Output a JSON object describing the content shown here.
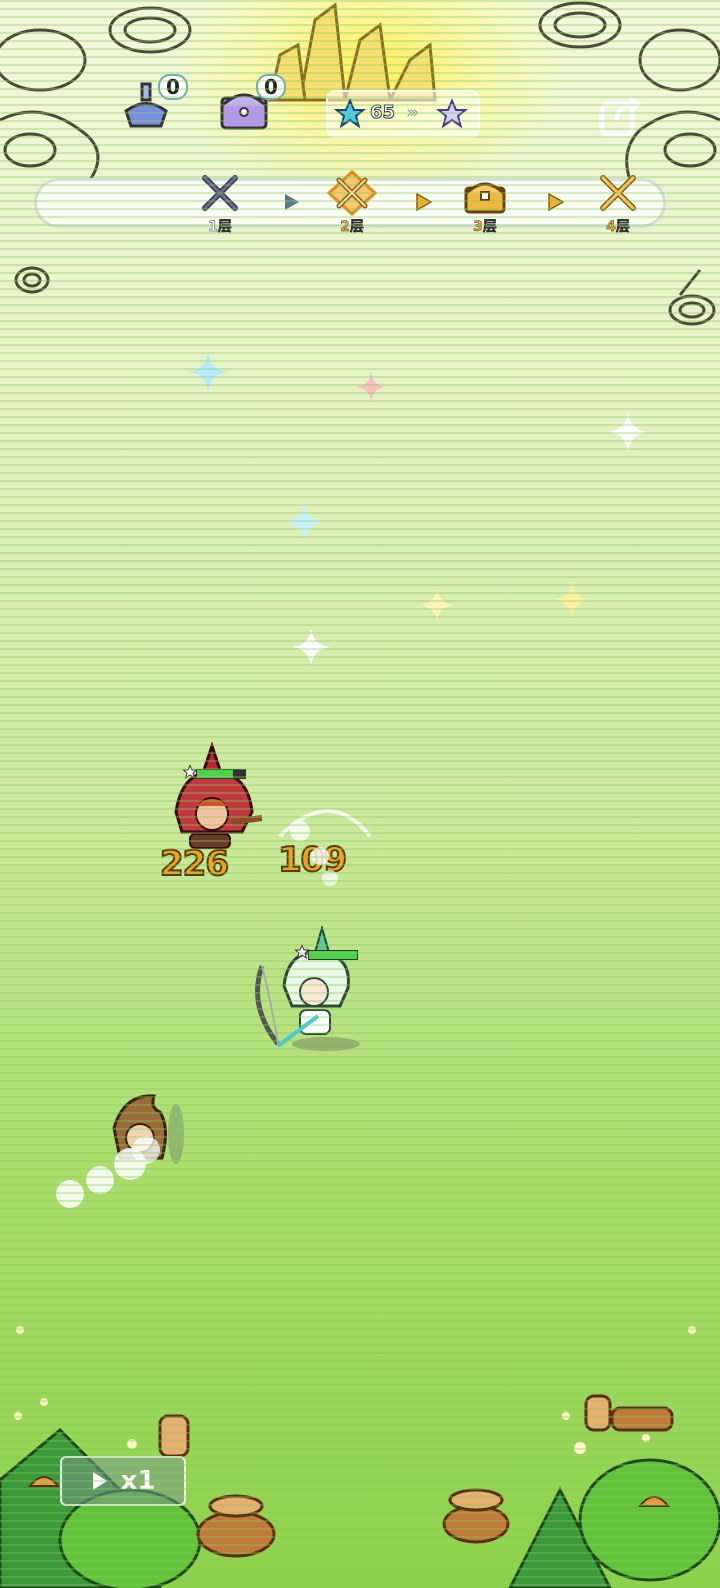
{
  "resources": [
    {
      "name": "potion-resource",
      "count": "0"
    },
    {
      "name": "chest-resource",
      "count": "0"
    }
  ],
  "stars": {
    "value": "65"
  },
  "stages": [
    {
      "label": "1层",
      "state": "current",
      "color": "#ffffff"
    },
    {
      "label": "2层",
      "state": "battle",
      "color": "#f0b030"
    },
    {
      "label": "3层",
      "state": "treasure",
      "color": "#f0b030"
    },
    {
      "label": "4层",
      "state": "battle",
      "color": "#f0b030"
    }
  ],
  "damage_numbers": [
    "226",
    "109"
  ],
  "speed": {
    "label": "x1"
  },
  "colors": {
    "accent": "#f0a21a",
    "hp": "#4cd24a"
  }
}
